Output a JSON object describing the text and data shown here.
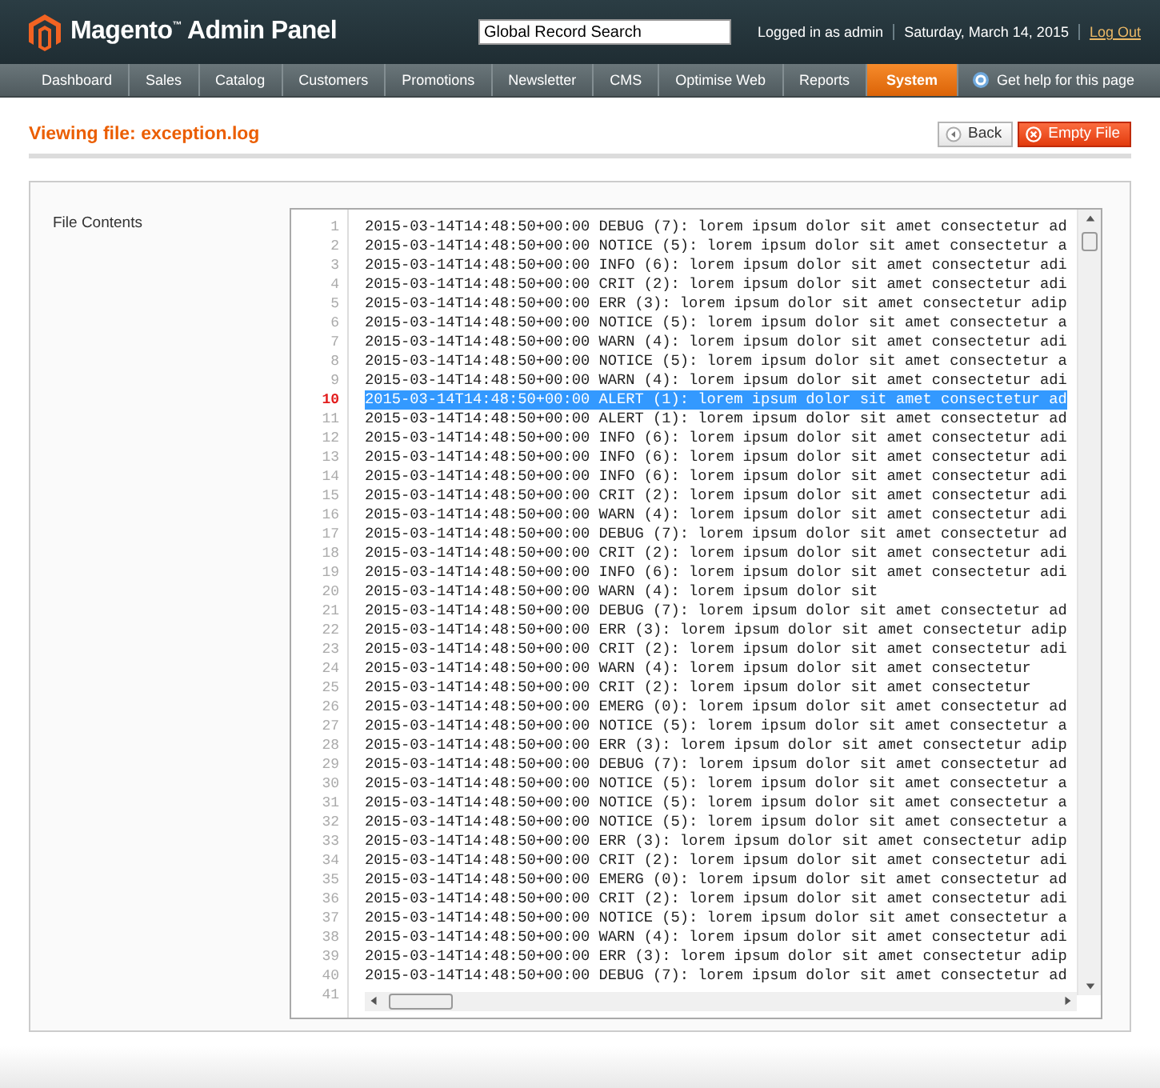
{
  "header": {
    "logo": "Magento$^{™}$ Admin Panel",
    "search": {
      "value": "Global Record Search"
    },
    "user": "Logged in as admin",
    "date": "Saturday, March 14, 2015",
    "logout": "Log Out"
  },
  "nav": [
    {
      "label": "Dashboard",
      "selected": false
    },
    {
      "label": "Sales",
      "selected": false
    },
    {
      "label": "Catalog",
      "selected": false
    },
    {
      "label": "Customers",
      "selected": false
    },
    {
      "label": "Promotions",
      "selected": false
    },
    {
      "label": "Newsletter",
      "selected": false
    },
    {
      "label": "CMS",
      "selected": false
    },
    {
      "label": "Optimise Web",
      "selected": false
    },
    {
      "label": "Reports",
      "selected": false
    },
    {
      "label": "System",
      "selected": true
    }
  ],
  "help": "Get help for this page",
  "page": {
    "title": "Viewing file: exception.log",
    "buttons": [
      {
        "label": "Back",
        "kind": "back"
      },
      {
        "label": "Empty File",
        "kind": "delete"
      }
    ]
  },
  "file": {
    "label": "File Contents",
    "lines": [
      {
        "number": "1",
        "text": "2015-03-14T14:48:50+00:00 DEBUG (7): lorem ipsum dolor sit amet consectetur ad",
        "selected": false
      },
      {
        "number": "2",
        "text": "2015-03-14T14:48:50+00:00 NOTICE (5): lorem ipsum dolor sit amet consectetur a",
        "selected": false
      },
      {
        "number": "3",
        "text": "2015-03-14T14:48:50+00:00 INFO (6): lorem ipsum dolor sit amet consectetur adi",
        "selected": false
      },
      {
        "number": "4",
        "text": "2015-03-14T14:48:50+00:00 CRIT (2): lorem ipsum dolor sit amet consectetur adi",
        "selected": false
      },
      {
        "number": "5",
        "text": "2015-03-14T14:48:50+00:00 ERR (3): lorem ipsum dolor sit amet consectetur adip",
        "selected": false
      },
      {
        "number": "6",
        "text": "2015-03-14T14:48:50+00:00 NOTICE (5): lorem ipsum dolor sit amet consectetur a",
        "selected": false
      },
      {
        "number": "7",
        "text": "2015-03-14T14:48:50+00:00 WARN (4): lorem ipsum dolor sit amet consectetur adi",
        "selected": false
      },
      {
        "number": "8",
        "text": "2015-03-14T14:48:50+00:00 NOTICE (5): lorem ipsum dolor sit amet consectetur a",
        "selected": false
      },
      {
        "number": "9",
        "text": "2015-03-14T14:48:50+00:00 WARN (4): lorem ipsum dolor sit amet consectetur adi",
        "selected": false
      },
      {
        "number": "10",
        "text": "2015-03-14T14:48:50+00:00 ALERT (1): lorem ipsum dolor sit amet consectetur ad",
        "selected": true
      },
      {
        "number": "11",
        "text": "2015-03-14T14:48:50+00:00 ALERT (1): lorem ipsum dolor sit amet consectetur ad",
        "selected": false
      },
      {
        "number": "12",
        "text": "2015-03-14T14:48:50+00:00 INFO (6): lorem ipsum dolor sit amet consectetur adi",
        "selected": false
      },
      {
        "number": "13",
        "text": "2015-03-14T14:48:50+00:00 INFO (6): lorem ipsum dolor sit amet consectetur adi",
        "selected": false
      },
      {
        "number": "14",
        "text": "2015-03-14T14:48:50+00:00 INFO (6): lorem ipsum dolor sit amet consectetur adi",
        "selected": false
      },
      {
        "number": "15",
        "text": "2015-03-14T14:48:50+00:00 CRIT (2): lorem ipsum dolor sit amet consectetur adi",
        "selected": false
      },
      {
        "number": "16",
        "text": "2015-03-14T14:48:50+00:00 WARN (4): lorem ipsum dolor sit amet consectetur adi",
        "selected": false
      },
      {
        "number": "17",
        "text": "2015-03-14T14:48:50+00:00 DEBUG (7): lorem ipsum dolor sit amet consectetur ad",
        "selected": false
      },
      {
        "number": "18",
        "text": "2015-03-14T14:48:50+00:00 CRIT (2): lorem ipsum dolor sit amet consectetur adi",
        "selected": false
      },
      {
        "number": "19",
        "text": "2015-03-14T14:48:50+00:00 INFO (6): lorem ipsum dolor sit amet consectetur adi",
        "selected": false
      },
      {
        "number": "20",
        "text": "2015-03-14T14:48:50+00:00 WARN (4): lorem ipsum dolor sit",
        "selected": false
      },
      {
        "number": "21",
        "text": "2015-03-14T14:48:50+00:00 DEBUG (7): lorem ipsum dolor sit amet consectetur ad",
        "selected": false
      },
      {
        "number": "22",
        "text": "2015-03-14T14:48:50+00:00 ERR (3): lorem ipsum dolor sit amet consectetur adip",
        "selected": false
      },
      {
        "number": "23",
        "text": "2015-03-14T14:48:50+00:00 CRIT (2): lorem ipsum dolor sit amet consectetur adi",
        "selected": false
      },
      {
        "number": "24",
        "text": "2015-03-14T14:48:50+00:00 WARN (4): lorem ipsum dolor sit amet consectetur",
        "selected": false
      },
      {
        "number": "25",
        "text": "2015-03-14T14:48:50+00:00 CRIT (2): lorem ipsum dolor sit amet consectetur",
        "selected": false
      },
      {
        "number": "26",
        "text": "2015-03-14T14:48:50+00:00 EMERG (0): lorem ipsum dolor sit amet consectetur ad",
        "selected": false
      },
      {
        "number": "27",
        "text": "2015-03-14T14:48:50+00:00 NOTICE (5): lorem ipsum dolor sit amet consectetur a",
        "selected": false
      },
      {
        "number": "28",
        "text": "2015-03-14T14:48:50+00:00 ERR (3): lorem ipsum dolor sit amet consectetur adip",
        "selected": false
      },
      {
        "number": "29",
        "text": "2015-03-14T14:48:50+00:00 DEBUG (7): lorem ipsum dolor sit amet consectetur ad",
        "selected": false
      },
      {
        "number": "30",
        "text": "2015-03-14T14:48:50+00:00 NOTICE (5): lorem ipsum dolor sit amet consectetur a",
        "selected": false
      },
      {
        "number": "31",
        "text": "2015-03-14T14:48:50+00:00 NOTICE (5): lorem ipsum dolor sit amet consectetur a",
        "selected": false
      },
      {
        "number": "32",
        "text": "2015-03-14T14:48:50+00:00 NOTICE (5): lorem ipsum dolor sit amet consectetur a",
        "selected": false
      },
      {
        "number": "33",
        "text": "2015-03-14T14:48:50+00:00 ERR (3): lorem ipsum dolor sit amet consectetur adip",
        "selected": false
      },
      {
        "number": "34",
        "text": "2015-03-14T14:48:50+00:00 CRIT (2): lorem ipsum dolor sit amet consectetur adi",
        "selected": false
      },
      {
        "number": "35",
        "text": "2015-03-14T14:48:50+00:00 EMERG (0): lorem ipsum dolor sit amet consectetur ad",
        "selected": false
      },
      {
        "number": "36",
        "text": "2015-03-14T14:48:50+00:00 CRIT (2): lorem ipsum dolor sit amet consectetur adi",
        "selected": false
      },
      {
        "number": "37",
        "text": "2015-03-14T14:48:50+00:00 NOTICE (5): lorem ipsum dolor sit amet consectetur a",
        "selected": false
      },
      {
        "number": "38",
        "text": "2015-03-14T14:48:50+00:00 WARN (4): lorem ipsum dolor sit amet consectetur adi",
        "selected": false
      },
      {
        "number": "39",
        "text": "2015-03-14T14:48:50+00:00 ERR (3): lorem ipsum dolor sit amet consectetur adip",
        "selected": false
      },
      {
        "number": "40",
        "text": "2015-03-14T14:48:50+00:00 DEBUG (7): lorem ipsum dolor sit amet consectetur ad",
        "selected": false
      },
      {
        "number": "41",
        "selected": false
      }
    ]
  }
}
